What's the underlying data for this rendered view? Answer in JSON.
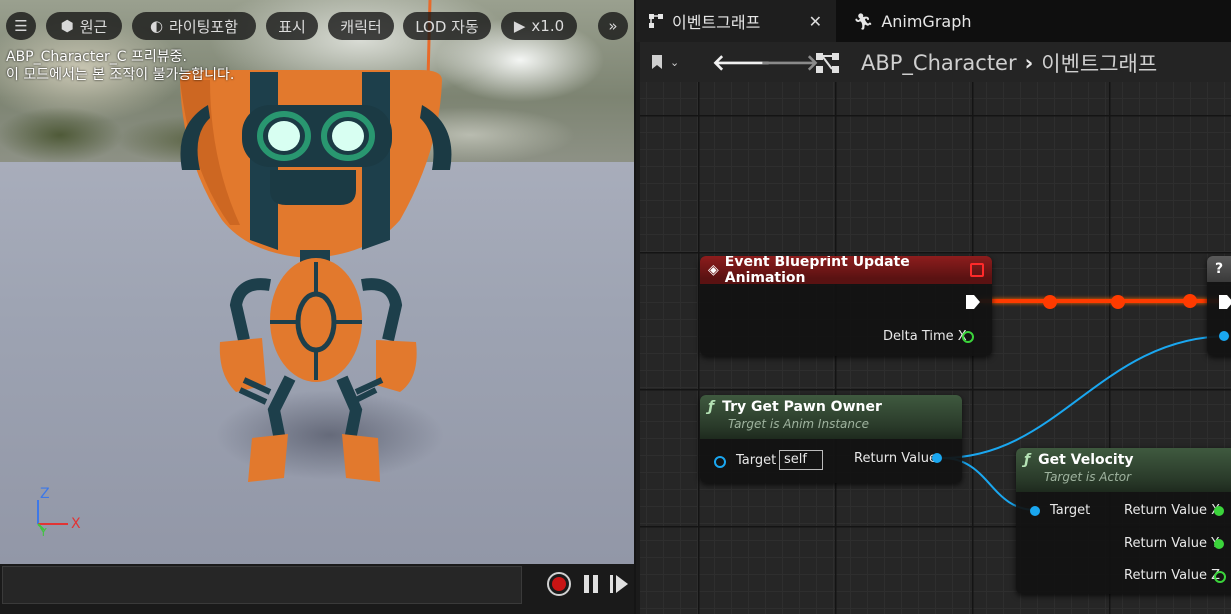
{
  "viewport": {
    "toolbar": {
      "menu_icon": "hamburger-icon",
      "perspective_label": "원근",
      "lighting_label": "라이팅포함",
      "show_label": "표시",
      "character_label": "캐릭터",
      "lod_label": "LOD 자동",
      "playback_speed": "x1.0",
      "more_icon": "double-chevron-right-icon"
    },
    "message_line1": "ABP_Character_C 프리뷰중.",
    "message_line2": "이 모드에서는 본 조작이 불가능합니다.",
    "axis": {
      "x": "X",
      "y": "Y",
      "z": "Z"
    },
    "colors": {
      "record": "#c81414",
      "axis_x": "#e23434",
      "axis_y": "#3fc43f",
      "axis_z": "#3d78e8"
    }
  },
  "editor": {
    "tabs": [
      {
        "label": "이벤트그래프",
        "icon": "graph-icon",
        "close_icon": "close-icon"
      },
      {
        "label": "AnimGraph",
        "icon": "running-man-icon"
      }
    ],
    "breadcrumb": {
      "root": "ABP_Character",
      "separator": "›",
      "current": "이벤트그래프"
    },
    "nodes": {
      "event": {
        "title": "Event Blueprint Update Animation",
        "pin_delta": "Delta Time X"
      },
      "pawn": {
        "title": "Try Get Pawn Owner",
        "subtitle": "Target is Anim Instance",
        "pin_target": "Target",
        "target_default": "self",
        "pin_return": "Return Value"
      },
      "velocity": {
        "title": "Get Velocity",
        "subtitle": "Target is Actor",
        "pin_target": "Target",
        "ret_x": "Return Value X",
        "ret_y": "Return Value Y",
        "ret_z": "Return Value Z"
      },
      "partial": {
        "head_glyph": "?"
      }
    },
    "colors": {
      "exec_wire": "#ff3b00",
      "object_wire": "#1aa7f0",
      "event_header": "#8d1d1d",
      "function_header": "#3f5a3f"
    }
  }
}
